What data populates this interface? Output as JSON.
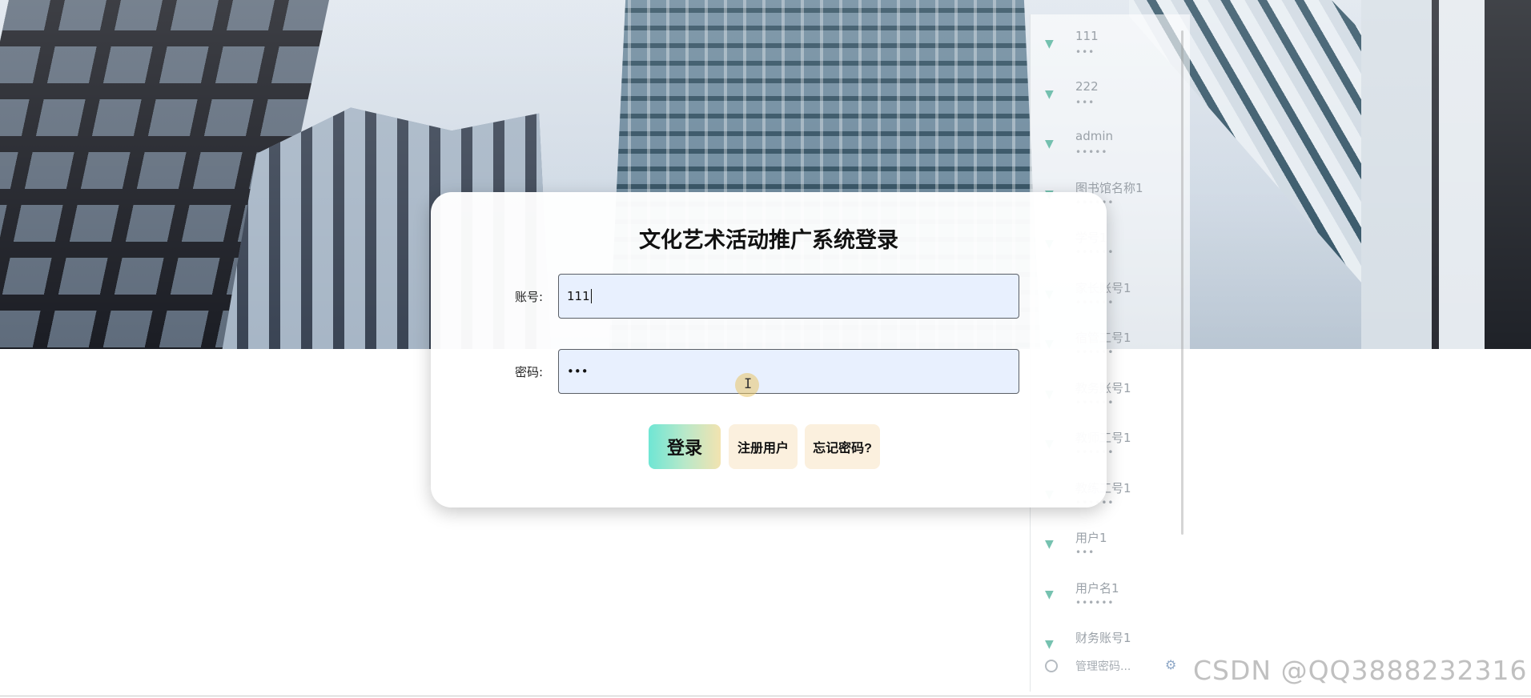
{
  "login": {
    "title": "文化艺术活动推广系统登录",
    "account_label": "账号:",
    "account_value": "111",
    "password_label": "密码:",
    "password_value": "•••",
    "login_button": "登录",
    "register_button": "注册用户",
    "forgot_button": "忘记密码?"
  },
  "autofill": {
    "items": [
      {
        "name": "111",
        "pass": "•••"
      },
      {
        "name": "222",
        "pass": "•••"
      },
      {
        "name": "admin",
        "pass": "•••••"
      },
      {
        "name": "图书馆名称1",
        "pass": "••••••"
      },
      {
        "name": "学号1",
        "pass": "••••••"
      },
      {
        "name": "家长账号1",
        "pass": "••••••"
      },
      {
        "name": "宿管工号1",
        "pass": "••••••"
      },
      {
        "name": "教务账号1",
        "pass": "••••••"
      },
      {
        "name": "教师工号1",
        "pass": "••••••"
      },
      {
        "name": "教练工号1",
        "pass": "••••••"
      },
      {
        "name": "用户1",
        "pass": "•••"
      },
      {
        "name": "用户名1",
        "pass": "••••••"
      },
      {
        "name": "财务账号1",
        "pass": ""
      }
    ],
    "footer_label": "管理密码..."
  },
  "watermark": "CSDN @QQ3888232316",
  "icons": {
    "autofill_item": "key-icon",
    "footer": "key-manager-icon",
    "settings": "gear-icon"
  }
}
